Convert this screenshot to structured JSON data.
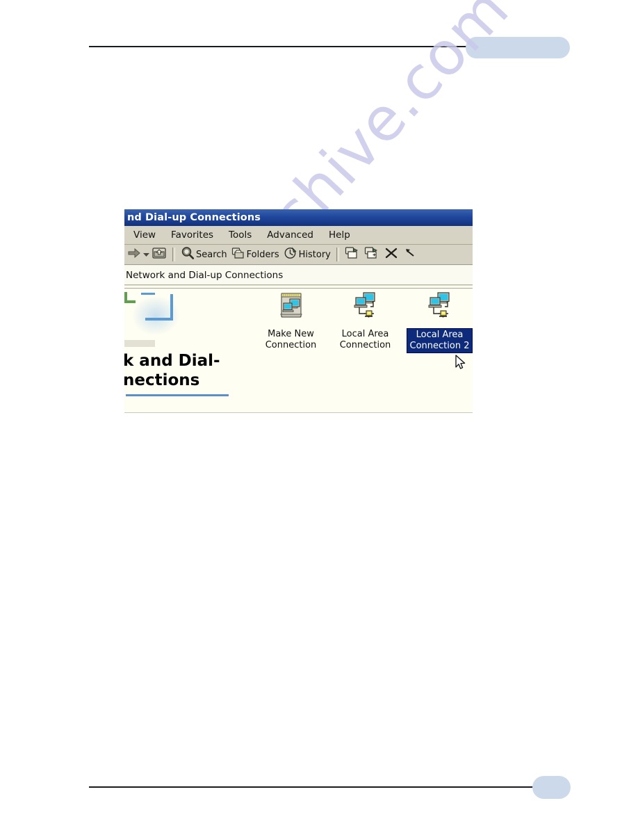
{
  "page": {
    "background": "#ffffff",
    "accent_pill_color": "#ccd9ea",
    "rule_color": "#1a1a22",
    "watermark": "manualshive.com"
  },
  "window": {
    "title": "nd Dial-up Connections",
    "title_full": "Network and Dial-up Connections",
    "titlebar_color": "#20479d",
    "menu": [
      {
        "label": "View"
      },
      {
        "label": "Favorites"
      },
      {
        "label": "Tools"
      },
      {
        "label": "Advanced"
      },
      {
        "label": "Help"
      }
    ],
    "toolbar": {
      "forward_icon": "forward-arrow-icon",
      "dropdown_icon": "chevron-down-icon",
      "up_icon": "up-folder-icon",
      "buttons": [
        {
          "label": "Search",
          "icon": "search-icon"
        },
        {
          "label": "Folders",
          "icon": "folders-icon"
        },
        {
          "label": "History",
          "icon": "history-icon"
        }
      ],
      "icon_buttons": [
        {
          "icon": "move-to-icon",
          "label": "Move To"
        },
        {
          "icon": "copy-to-icon",
          "label": "Copy To"
        },
        {
          "icon": "delete-icon",
          "label": "Delete"
        },
        {
          "icon": "undo-icon",
          "label": "Undo"
        }
      ]
    },
    "address": {
      "value": "Network and Dial-up Connections"
    },
    "branding": {
      "heading_line1": "k and Dial-",
      "heading_line2": "nections",
      "heading_full": "Network and Dial-up Connections"
    },
    "items": [
      {
        "label": "Make New\nConnection",
        "icon": "new-connection-wizard-icon",
        "selected": false
      },
      {
        "label": "Local Area\nConnection",
        "icon": "lan-connection-icon",
        "selected": false
      },
      {
        "label": "Local Area\nConnection 2",
        "icon": "lan-connection-icon",
        "selected": true
      }
    ],
    "selection_color": "#0d2b7a",
    "cursor": "mouse-pointer-icon"
  }
}
